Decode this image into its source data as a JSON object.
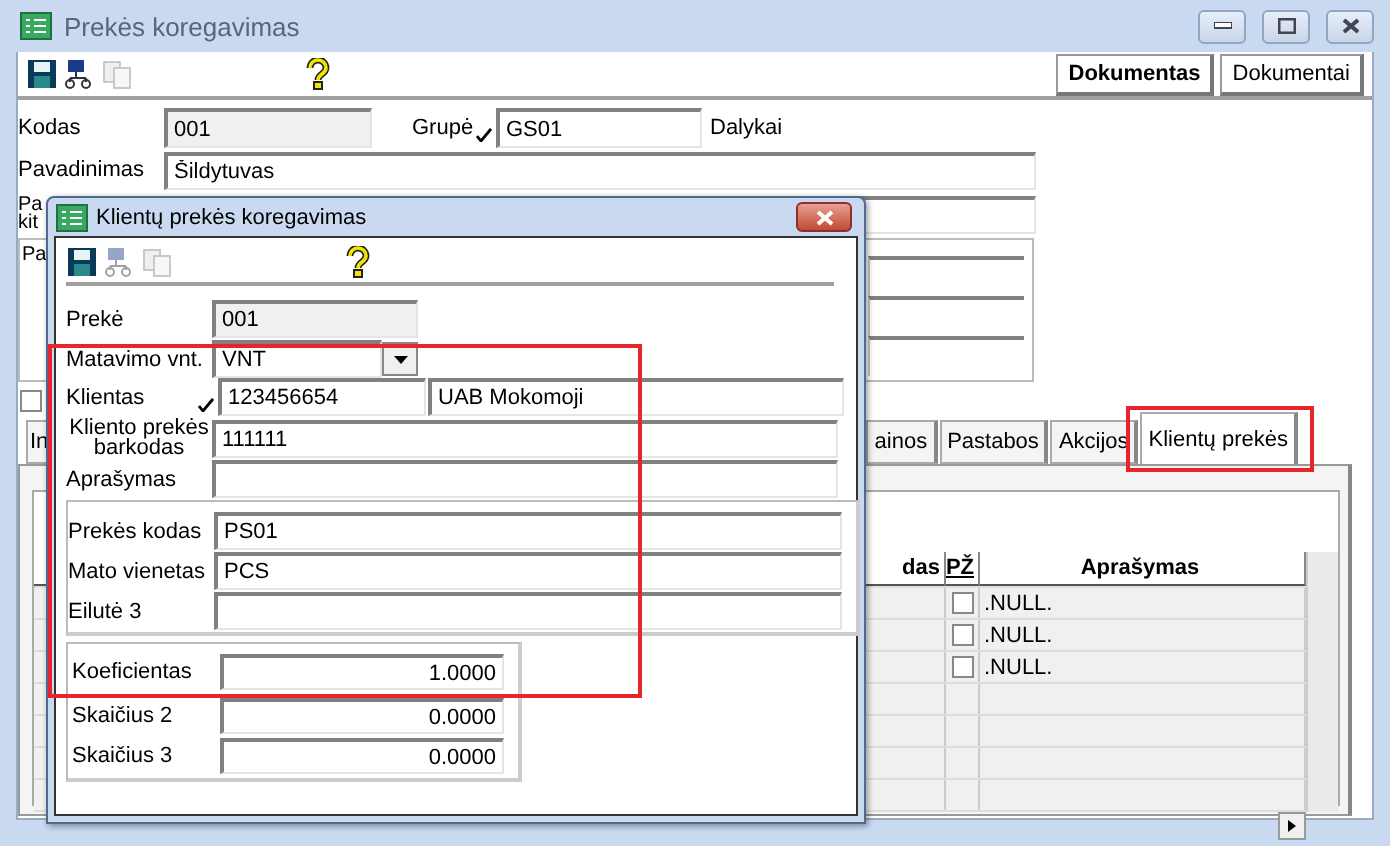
{
  "window": {
    "title": "Prekės koregavimas"
  },
  "header_buttons": [
    {
      "label": "Dokumentas",
      "selected": true
    },
    {
      "label": "Dokumentai",
      "selected": false
    }
  ],
  "main_form": {
    "code": {
      "label": "Kodas",
      "value": "001",
      "readonly": true
    },
    "group": {
      "label": "Grupė",
      "value": "GS01",
      "validated": true,
      "suffix": "Dalykai"
    },
    "name": {
      "label": "Pavadinimas",
      "value": "Šildytuvas"
    },
    "name_other": {
      "label_lines": [
        "Pa",
        "kit"
      ]
    },
    "notes_box": {
      "label": "Pa"
    },
    "checkbox": {
      "checked": false
    }
  },
  "tabs": [
    {
      "label": "In",
      "selected": false
    },
    {
      "label": "ainos",
      "selected": false
    },
    {
      "label": "Pastabos",
      "selected": false
    },
    {
      "label": "Akcijos",
      "selected": false
    },
    {
      "label": "Klientų prekės",
      "selected": true
    }
  ],
  "grid": {
    "columns": [
      "das",
      "PŽ",
      "Aprašymas"
    ],
    "rows": [
      {
        "checked": false,
        "description": ".NULL."
      },
      {
        "checked": false,
        "description": ".NULL."
      },
      {
        "checked": false,
        "description": ".NULL."
      }
    ]
  },
  "dialog": {
    "title": "Klientų prekės koregavimas",
    "fields": [
      {
        "kind": "text",
        "label_lines": [
          "Prekė"
        ],
        "value": "001",
        "readonly": true
      },
      {
        "kind": "dropdown",
        "label_lines": [
          "Matavimo vnt."
        ],
        "value": "VNT"
      },
      {
        "kind": "double",
        "label_lines": [
          "Klientas"
        ],
        "value": "123456654",
        "value2": "UAB Mokomoji",
        "validated": true
      },
      {
        "kind": "text",
        "label_lines": [
          "Kliento prekės",
          "barkodas"
        ],
        "value": "111111"
      },
      {
        "kind": "text",
        "label_lines": [
          "Aprašymas"
        ]
      }
    ],
    "group_fields": [
      {
        "label": "Prekės kodas",
        "value": "PS01"
      },
      {
        "label": "Mato vienetas",
        "value": "PCS"
      },
      {
        "label": "Eilutė 3"
      }
    ],
    "number_fields": [
      {
        "label": "Koeficientas",
        "value": "1.0000"
      },
      {
        "label": "Skaičius 2",
        "value": "0.0000"
      },
      {
        "label": "Skaičius 3",
        "value": "0.0000"
      }
    ]
  }
}
